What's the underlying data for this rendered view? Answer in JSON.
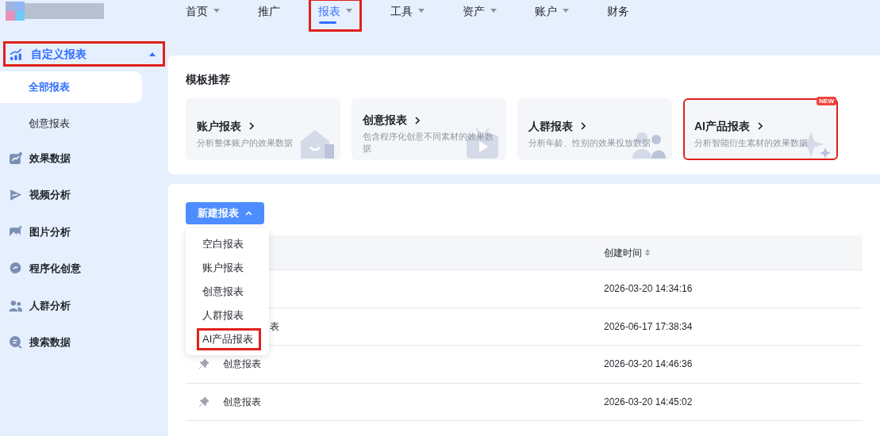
{
  "top_nav": [
    {
      "label": "首页",
      "caret": true,
      "selected": false,
      "highlighted": false
    },
    {
      "label": "推广",
      "caret": false,
      "selected": false,
      "highlighted": false
    },
    {
      "label": "报表",
      "caret": true,
      "selected": true,
      "highlighted": true
    },
    {
      "label": "工具",
      "caret": true,
      "selected": false,
      "highlighted": false
    },
    {
      "label": "资产",
      "caret": true,
      "selected": false,
      "highlighted": false
    },
    {
      "label": "账户",
      "caret": true,
      "selected": false,
      "highlighted": false
    },
    {
      "label": "财务",
      "caret": false,
      "selected": false,
      "highlighted": false
    }
  ],
  "sidebar": {
    "items": [
      {
        "label": "自定义报表",
        "expanded": true,
        "highlighted": true,
        "children": [
          {
            "label": "全部报表",
            "selected": true
          },
          {
            "label": "创意报表",
            "selected": false
          }
        ]
      },
      {
        "label": "效果数据"
      },
      {
        "label": "视频分析"
      },
      {
        "label": "图片分析"
      },
      {
        "label": "程序化创意"
      },
      {
        "label": "人群分析"
      },
      {
        "label": "搜索数据"
      }
    ]
  },
  "templates": {
    "title": "模板推荐",
    "cards": [
      {
        "title": "账户报表",
        "description": "分析整体账户的效果数据",
        "highlighted": false
      },
      {
        "title": "创意报表",
        "description": "包含程序化创意不同素材的效果数据",
        "highlighted": false
      },
      {
        "title": "人群报表",
        "description": "分析年龄、性别的效果投放数据",
        "highlighted": false
      },
      {
        "title": "AI产品报表",
        "description": "分析智能衍生素材的效果数据",
        "badge": "NEW",
        "highlighted": true
      }
    ]
  },
  "new_report": {
    "label": "新建报表",
    "expanded": true,
    "menu": [
      {
        "label": "空白报表",
        "highlighted": false
      },
      {
        "label": "账户报表",
        "highlighted": false
      },
      {
        "label": "创意报表",
        "highlighted": false
      },
      {
        "label": "人群报表",
        "highlighted": false
      },
      {
        "label": "AI产品报表",
        "highlighted": true
      }
    ]
  },
  "table": {
    "columns": [
      "创建时间"
    ],
    "rows": [
      {
        "name": null,
        "kind": "hidden",
        "created": "2026-03-20 14:34:16"
      },
      {
        "name": "表",
        "kind": "cut",
        "created": "2026-06-17 17:38:34"
      },
      {
        "name": "创意报表",
        "kind": "full",
        "created": "2026-03-20 14:46:36"
      },
      {
        "name": "创意报表",
        "kind": "full",
        "created": "2026-03-20 14:45:02"
      }
    ]
  }
}
